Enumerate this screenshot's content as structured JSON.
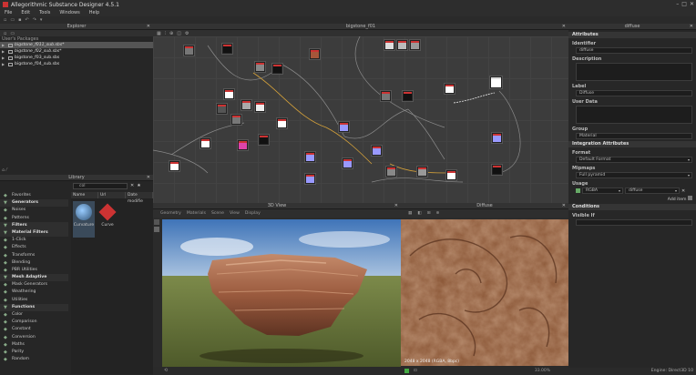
{
  "window": {
    "title": "Allegorithmic Substance Designer 4.5.1"
  },
  "menu": [
    "File",
    "Edit",
    "Tools",
    "Windows",
    "Help"
  ],
  "explorer": {
    "title": "Explorer",
    "sub_label": "User's Packages",
    "packages": [
      {
        "name": "bigstone_f011_sub.sbs*",
        "selected": true
      },
      {
        "name": "bigstone_f02_sub.sbs*",
        "selected": false
      },
      {
        "name": "bigstone_f03_sub.sbs",
        "selected": false
      },
      {
        "name": "bigstone_f04_sub.sbs",
        "selected": false
      }
    ]
  },
  "library": {
    "title": "Library",
    "search_value": "col",
    "columns": [
      "Name",
      "Url",
      "Date modifie"
    ],
    "categories": [
      {
        "label": "Favorites",
        "header": false,
        "icon": "star-icon"
      },
      {
        "label": "Generators",
        "header": true,
        "icon": "generator-icon"
      },
      {
        "label": "Noises",
        "header": false,
        "icon": "noise-icon"
      },
      {
        "label": "Patterns",
        "header": false,
        "icon": "pattern-icon"
      },
      {
        "label": "Filters",
        "header": true,
        "icon": "filter-icon"
      },
      {
        "label": "Material Filters",
        "header": true,
        "icon": "material-icon"
      },
      {
        "label": "1-Click",
        "header": false,
        "icon": "heart-icon"
      },
      {
        "label": "Effects",
        "header": false,
        "icon": "effects-icon"
      },
      {
        "label": "Transforms",
        "header": false,
        "icon": "transform-icon"
      },
      {
        "label": "Blending",
        "header": false,
        "icon": "blend-icon"
      },
      {
        "label": "PBR Utilities",
        "header": false,
        "icon": "pbr-icon"
      },
      {
        "label": "Mesh Adaptive",
        "header": true,
        "icon": "mesh-icon"
      },
      {
        "label": "Mask Generators",
        "header": false,
        "icon": "mask-icon"
      },
      {
        "label": "Weathering",
        "header": false,
        "icon": "weather-icon"
      },
      {
        "label": "Utilities",
        "header": false,
        "icon": "utility-icon"
      },
      {
        "label": "Functions",
        "header": true,
        "icon": "function-icon"
      },
      {
        "label": "Color",
        "header": false,
        "icon": "fn-icon"
      },
      {
        "label": "Comparison",
        "header": false,
        "icon": "fn-icon"
      },
      {
        "label": "Constant",
        "header": false,
        "icon": "fn-icon"
      },
      {
        "label": "Conversion",
        "header": false,
        "icon": "fn-icon"
      },
      {
        "label": "Maths",
        "header": false,
        "icon": "fn-icon"
      },
      {
        "label": "Parity",
        "header": false,
        "icon": "fn-icon"
      },
      {
        "label": "Random",
        "header": false,
        "icon": "fn-icon"
      }
    ],
    "results": [
      {
        "label": "Curvature"
      },
      {
        "label": "Curve"
      }
    ]
  },
  "graph": {
    "title": "bigstone_f01"
  },
  "view3d": {
    "title": "3D View",
    "menu": [
      "Geometry",
      "Materials",
      "Scene",
      "View",
      "Display"
    ]
  },
  "view2d": {
    "title": "Diffuse",
    "image_info": "2048 x 2048 (RGBA, 8bpc)",
    "zoom": "33.00%"
  },
  "attributes": {
    "title": "diffuse",
    "section_attributes": "Attributes",
    "identifier_label": "Identifier",
    "identifier_value": "diffuse",
    "description_label": "Description",
    "label_label": "Label",
    "label_value": "Diffuse",
    "userdata_label": "User Data",
    "group_label": "Group",
    "group_value": "Material",
    "section_integration": "Integration Attributes",
    "format_label": "Format",
    "format_value": "Default Format",
    "mipmaps_label": "Mipmaps",
    "mipmaps_value": "Full pyramid",
    "usage_label": "Usage",
    "usage_channel": "RGBA",
    "usage_value": "diffuse",
    "add_item": "Add item",
    "section_conditions": "Conditions",
    "visible_label": "Visible If"
  },
  "status": {
    "engine": "Engine: Direct3D 10"
  }
}
